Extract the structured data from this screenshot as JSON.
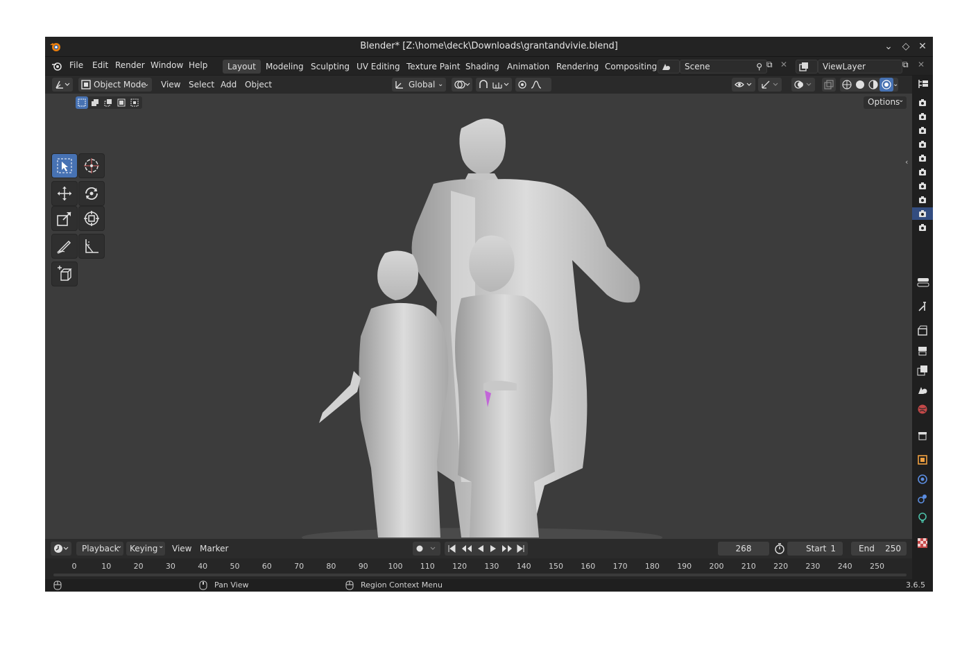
{
  "window": {
    "title": "Blender* [Z:\\home\\deck\\Downloads\\grantandvivie.blend]",
    "controls": [
      "chevron-down-icon",
      "restore-icon",
      "close-icon"
    ]
  },
  "menu": {
    "items": [
      "File",
      "Edit",
      "Render",
      "Window",
      "Help"
    ],
    "workspaces": [
      "Layout",
      "Modeling",
      "Sculpting",
      "UV Editing",
      "Texture Paint",
      "Shading",
      "Animation",
      "Rendering",
      "Compositing"
    ],
    "active_workspace": "Layout",
    "scene": "Scene",
    "view_layer": "ViewLayer"
  },
  "viewport_header": {
    "mode": "Object Mode",
    "menus": [
      "View",
      "Select",
      "Add",
      "Object"
    ],
    "orientation": "Global",
    "options": "Options"
  },
  "tools": [
    "select-box-icon",
    "cursor-icon",
    "move-icon",
    "rotate-icon",
    "scale-icon",
    "transform-icon",
    "annotate-icon",
    "measure-icon",
    "add-cube-icon"
  ],
  "timeline": {
    "menus": [
      "Playback",
      "Keying",
      "View",
      "Marker"
    ],
    "current_frame": "268",
    "start_label": "Start",
    "start": "1",
    "end_label": "End",
    "end": "250",
    "ruler": [
      "0",
      "10",
      "20",
      "30",
      "40",
      "50",
      "60",
      "70",
      "80",
      "90",
      "100",
      "110",
      "120",
      "130",
      "140",
      "150",
      "160",
      "170",
      "180",
      "190",
      "200",
      "210",
      "220",
      "230",
      "240",
      "250"
    ]
  },
  "status": {
    "pan": "Pan View",
    "context": "Region Context Menu",
    "version": "3.6.5"
  },
  "colors": {
    "accent": "#4772b3",
    "viewport": "#3c3c3c",
    "panel": "#2a2a2a"
  }
}
